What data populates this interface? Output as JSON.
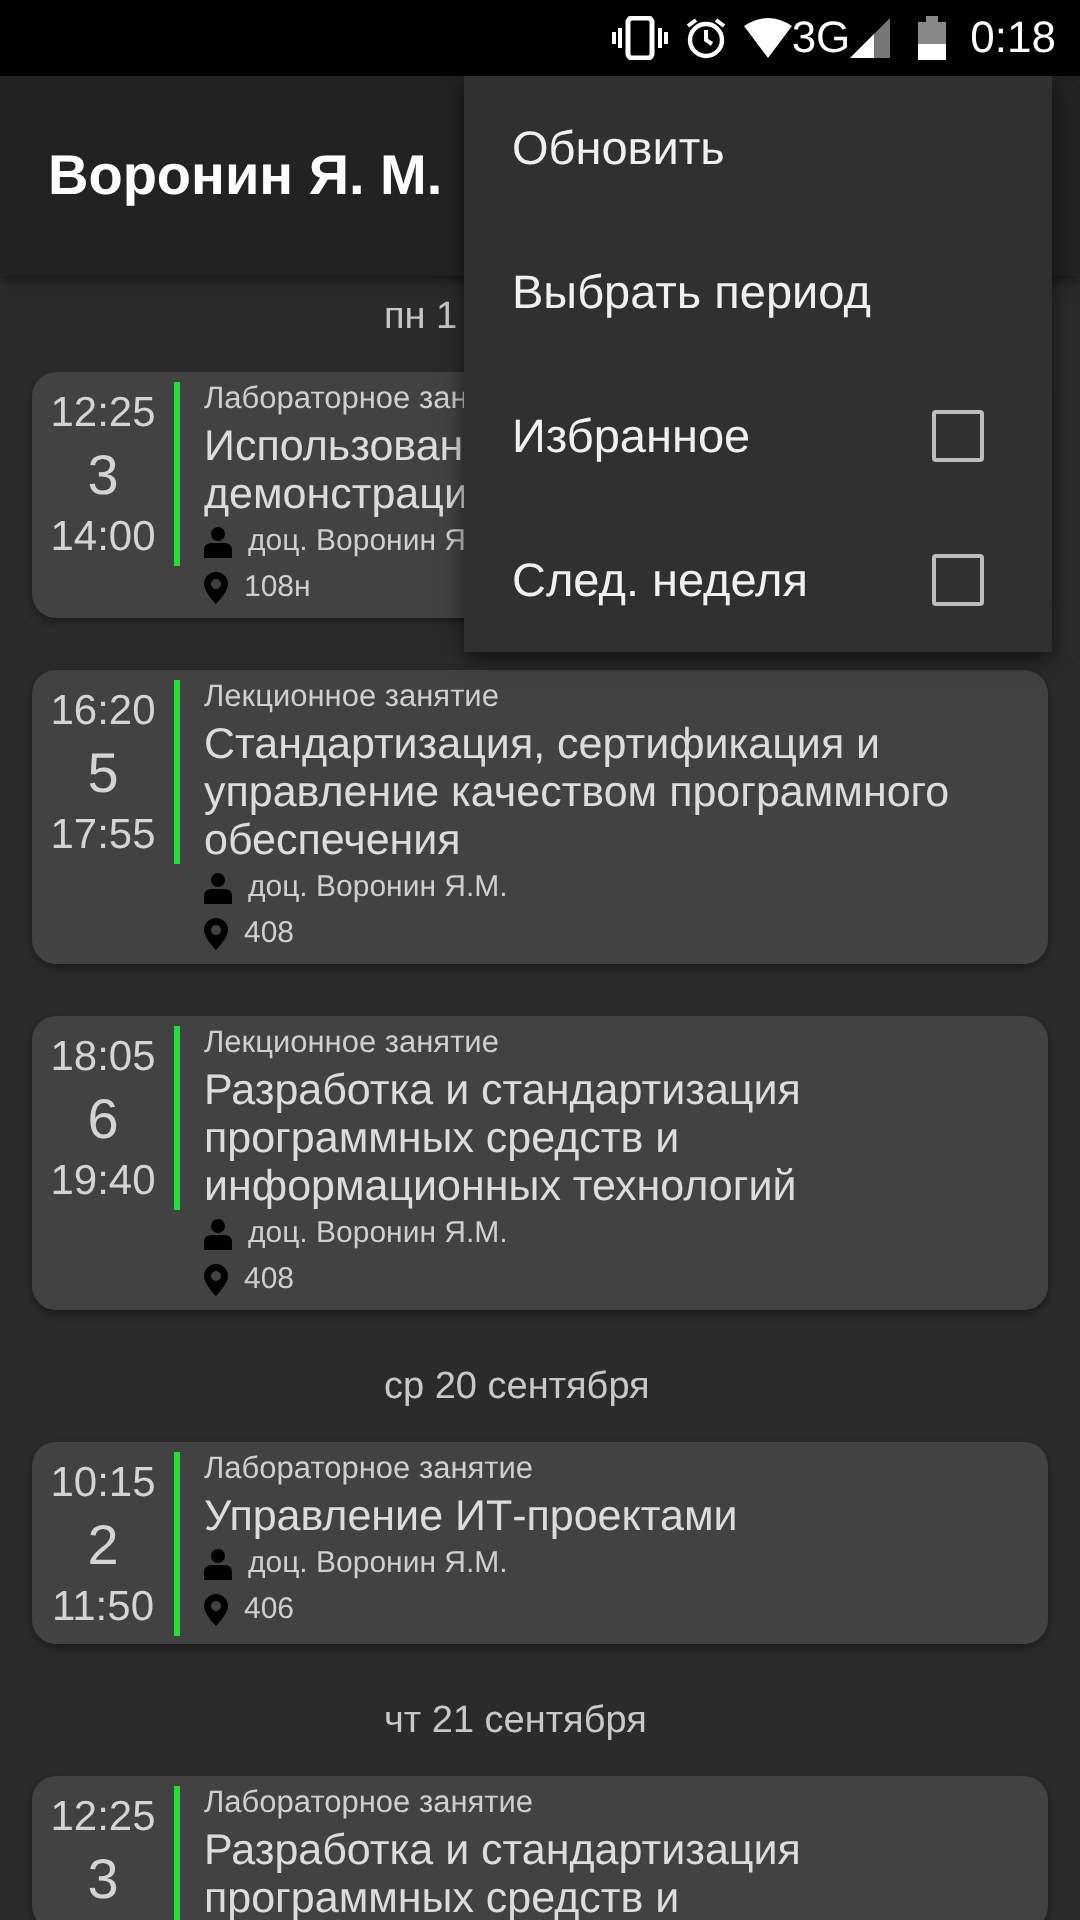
{
  "status_bar": {
    "network": "3G",
    "time": "0:18"
  },
  "app_bar": {
    "title": "Воронин Я. М."
  },
  "days": [
    {
      "header": "пн 1",
      "lessons": [
        {
          "start": "12:25",
          "number": "3",
          "end": "14:00",
          "type": "Лабораторное зан",
          "title": "Использован\nдемонстраци",
          "teacher": "доц. Воронин Я",
          "room": "108н"
        },
        {
          "start": "16:20",
          "number": "5",
          "end": "17:55",
          "type": "Лекционное занятие",
          "title": "Стандартизация, сертификация и управление качеством программного обеспечения",
          "teacher": "доц. Воронин Я.М.",
          "room": "408"
        },
        {
          "start": "18:05",
          "number": "6",
          "end": "19:40",
          "type": "Лекционное занятие",
          "title": "Разработка и стандартизация программных средств и информационных технологий",
          "teacher": "доц. Воронин Я.М.",
          "room": "408"
        }
      ]
    },
    {
      "header": "ср 20 сентября",
      "lessons": [
        {
          "start": "10:15",
          "number": "2",
          "end": "11:50",
          "type": "Лабораторное занятие",
          "title": "Управление ИТ-проектами",
          "teacher": "доц. Воронин Я.М.",
          "room": "406"
        }
      ]
    },
    {
      "header": "чт 21 сентября",
      "lessons": [
        {
          "start": "12:25",
          "number": "3",
          "type": "Лабораторное занятие",
          "title": "Разработка и стандартизация\nпрограммных средств и"
        }
      ]
    }
  ],
  "menu": {
    "items": [
      {
        "kind": "action",
        "label": "Обновить"
      },
      {
        "kind": "action",
        "label": "Выбрать период"
      },
      {
        "kind": "checkbox",
        "label": "Избранное",
        "checked": false
      },
      {
        "kind": "checkbox",
        "label": "След. неделя",
        "checked": false
      }
    ]
  }
}
